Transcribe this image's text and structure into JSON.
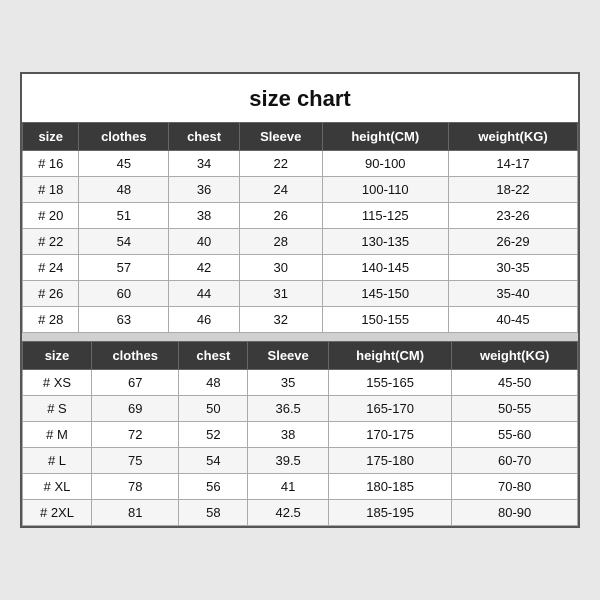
{
  "title": "size chart",
  "table1": {
    "headers": [
      "size",
      "clothes",
      "chest",
      "Sleeve",
      "height(CM)",
      "weight(KG)"
    ],
    "rows": [
      [
        "# 16",
        "45",
        "34",
        "22",
        "90-100",
        "14-17"
      ],
      [
        "# 18",
        "48",
        "36",
        "24",
        "100-110",
        "18-22"
      ],
      [
        "# 20",
        "51",
        "38",
        "26",
        "115-125",
        "23-26"
      ],
      [
        "# 22",
        "54",
        "40",
        "28",
        "130-135",
        "26-29"
      ],
      [
        "# 24",
        "57",
        "42",
        "30",
        "140-145",
        "30-35"
      ],
      [
        "# 26",
        "60",
        "44",
        "31",
        "145-150",
        "35-40"
      ],
      [
        "# 28",
        "63",
        "46",
        "32",
        "150-155",
        "40-45"
      ]
    ]
  },
  "table2": {
    "headers": [
      "size",
      "clothes",
      "chest",
      "Sleeve",
      "height(CM)",
      "weight(KG)"
    ],
    "rows": [
      [
        "# XS",
        "67",
        "48",
        "35",
        "155-165",
        "45-50"
      ],
      [
        "# S",
        "69",
        "50",
        "36.5",
        "165-170",
        "50-55"
      ],
      [
        "# M",
        "72",
        "52",
        "38",
        "170-175",
        "55-60"
      ],
      [
        "# L",
        "75",
        "54",
        "39.5",
        "175-180",
        "60-70"
      ],
      [
        "# XL",
        "78",
        "56",
        "41",
        "180-185",
        "70-80"
      ],
      [
        "# 2XL",
        "81",
        "58",
        "42.5",
        "185-195",
        "80-90"
      ]
    ]
  }
}
